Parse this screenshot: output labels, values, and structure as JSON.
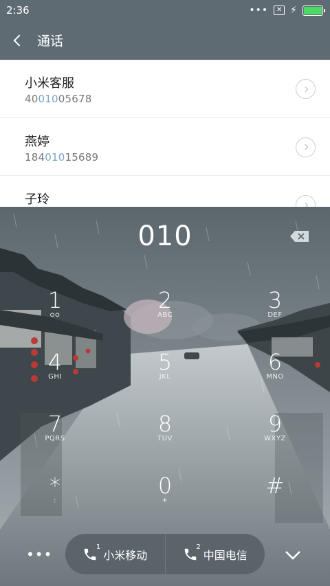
{
  "status_bar": {
    "time": "2:36",
    "icons": [
      "more-dots-icon",
      "sim-x-icon",
      "charging-bolt-icon",
      "battery-icon"
    ],
    "battery_fill": 1.0,
    "battery_color": "#4cd964"
  },
  "header": {
    "back_icon": "chevron-left-icon",
    "title": "通话",
    "background": "#5f6b73"
  },
  "contacts": [
    {
      "name": "小米客服",
      "number_before": "40",
      "number_match": "010",
      "number_after": "05678"
    },
    {
      "name": "燕婷",
      "number_before": "184",
      "number_match": "010",
      "number_after": "15689"
    },
    {
      "name": "子玲",
      "number_before": "",
      "number_match": "",
      "number_after": ""
    }
  ],
  "dialer": {
    "input": "010",
    "backspace_icon": "backspace-icon",
    "keys": [
      {
        "digit": "1",
        "letters": "ᴑᴑ"
      },
      {
        "digit": "2",
        "letters": "ABC"
      },
      {
        "digit": "3",
        "letters": "DEF"
      },
      {
        "digit": "4",
        "letters": "GHI"
      },
      {
        "digit": "5",
        "letters": "JKL"
      },
      {
        "digit": "6",
        "letters": "MNO"
      },
      {
        "digit": "7",
        "letters": "PQRS"
      },
      {
        "digit": "8",
        "letters": "TUV"
      },
      {
        "digit": "9",
        "letters": "WXYZ"
      },
      {
        "digit": "*",
        "letters": ":"
      },
      {
        "digit": "0",
        "letters": "+"
      },
      {
        "digit": "#",
        "letters": ""
      }
    ]
  },
  "bottom_bar": {
    "more_label": "•••",
    "sim1": {
      "label": "小米移动",
      "slot": "1"
    },
    "sim2": {
      "label": "中国电信",
      "slot": "2"
    },
    "collapse_icon": "chevron-down-icon"
  }
}
